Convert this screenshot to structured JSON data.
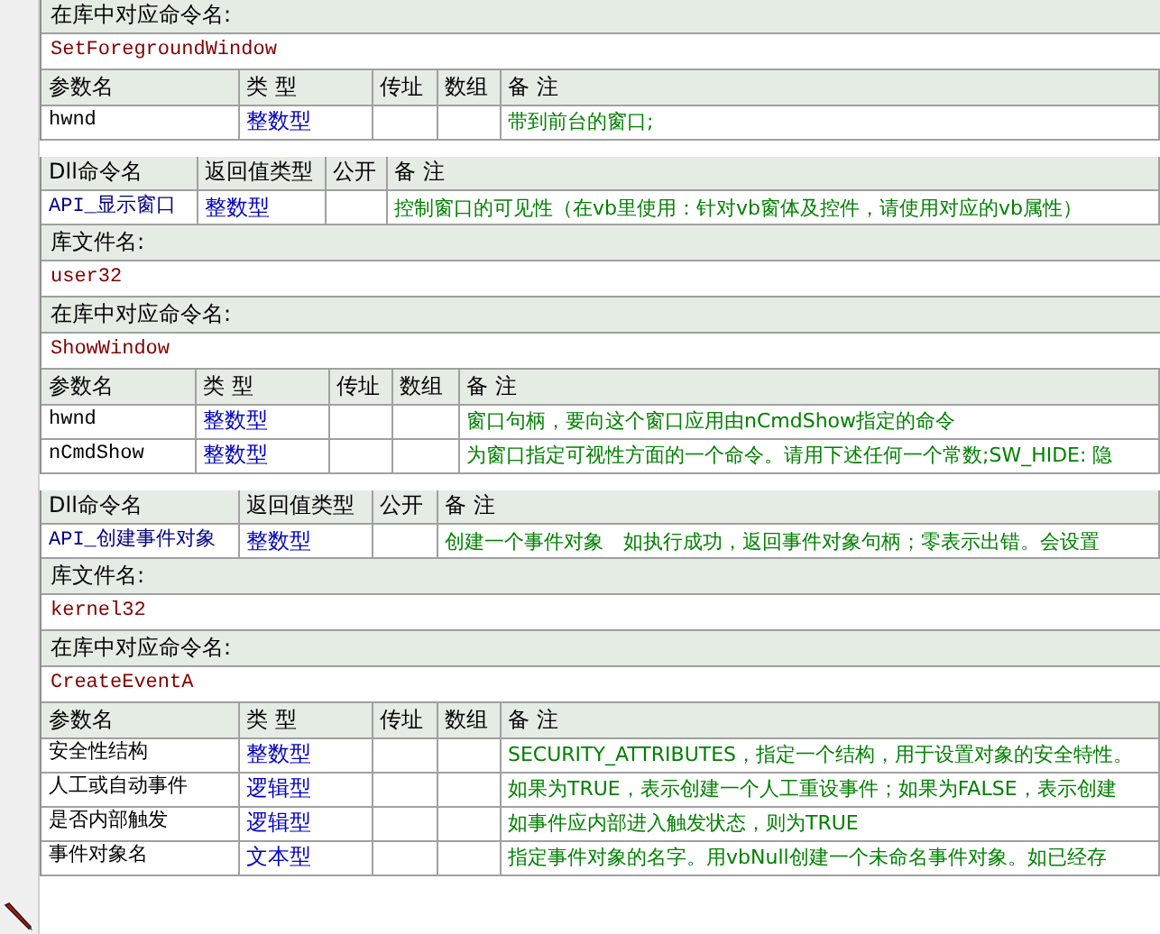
{
  "blocks": [
    {
      "parts": [
        {
          "kind": "label",
          "text": "在库中对应命令名:"
        },
        {
          "kind": "value",
          "text": "SetForegroundWindow"
        },
        {
          "kind": "params",
          "columns": [
            "参数名",
            "类 型",
            "传址",
            "数组",
            "备 注"
          ],
          "rows": [
            {
              "name": "hwnd",
              "type": "整数型",
              "note": "带到前台的窗口;"
            }
          ]
        }
      ]
    },
    {
      "parts": [
        {
          "kind": "command",
          "columns": [
            "Dll命令名",
            "返回值类型",
            "公开",
            "备 注"
          ],
          "rows": [
            {
              "name": "API_显示窗口",
              "type": "整数型",
              "note": "控制窗口的可见性（在vb里使用：针对vb窗体及控件，请使用对应的vb属性）"
            }
          ]
        },
        {
          "kind": "label",
          "text": "库文件名:"
        },
        {
          "kind": "value",
          "text": "user32"
        },
        {
          "kind": "label",
          "text": "在库中对应命令名:"
        },
        {
          "kind": "value",
          "text": "ShowWindow"
        },
        {
          "kind": "params",
          "columns": [
            "参数名",
            "类 型",
            "传址",
            "数组",
            "备 注"
          ],
          "rows": [
            {
              "name": "hwnd",
              "type": "整数型",
              "note": "窗口句柄，要向这个窗口应用由nCmdShow指定的命令"
            },
            {
              "name": "nCmdShow",
              "type": "整数型",
              "note": "为窗口指定可视性方面的一个命令。请用下述任何一个常数;SW_HIDE: 隐"
            }
          ]
        }
      ]
    },
    {
      "parts": [
        {
          "kind": "command",
          "columns": [
            "Dll命令名",
            "返回值类型",
            "公开",
            "备 注"
          ],
          "rows": [
            {
              "name": "API_创建事件对象",
              "type": "整数型",
              "note": "创建一个事件对象　如执行成功，返回事件对象句柄；零表示出错。会设置"
            }
          ]
        },
        {
          "kind": "label",
          "text": "库文件名:"
        },
        {
          "kind": "value",
          "text": "kernel32"
        },
        {
          "kind": "label",
          "text": "在库中对应命令名:"
        },
        {
          "kind": "value",
          "text": "CreateEventA"
        },
        {
          "kind": "params",
          "columns": [
            "参数名",
            "类 型",
            "传址",
            "数组",
            "备 注"
          ],
          "rows": [
            {
              "name": "安全性结构",
              "type": "整数型",
              "note": "SECURITY_ATTRIBUTES，指定一个结构，用于设置对象的安全特性。"
            },
            {
              "name": "人工或自动事件",
              "type": "逻辑型",
              "note": "如果为TRUE，表示创建一个人工重设事件；如果为FALSE，表示创建"
            },
            {
              "name": "是否内部触发",
              "type": "逻辑型",
              "note": "如事件应内部进入触发状态，则为TRUE"
            },
            {
              "name": "事件对象名",
              "type": "文本型",
              "note": "指定事件对象的名字。用vbNull创建一个未命名事件对象。如已经存"
            }
          ]
        }
      ]
    }
  ]
}
